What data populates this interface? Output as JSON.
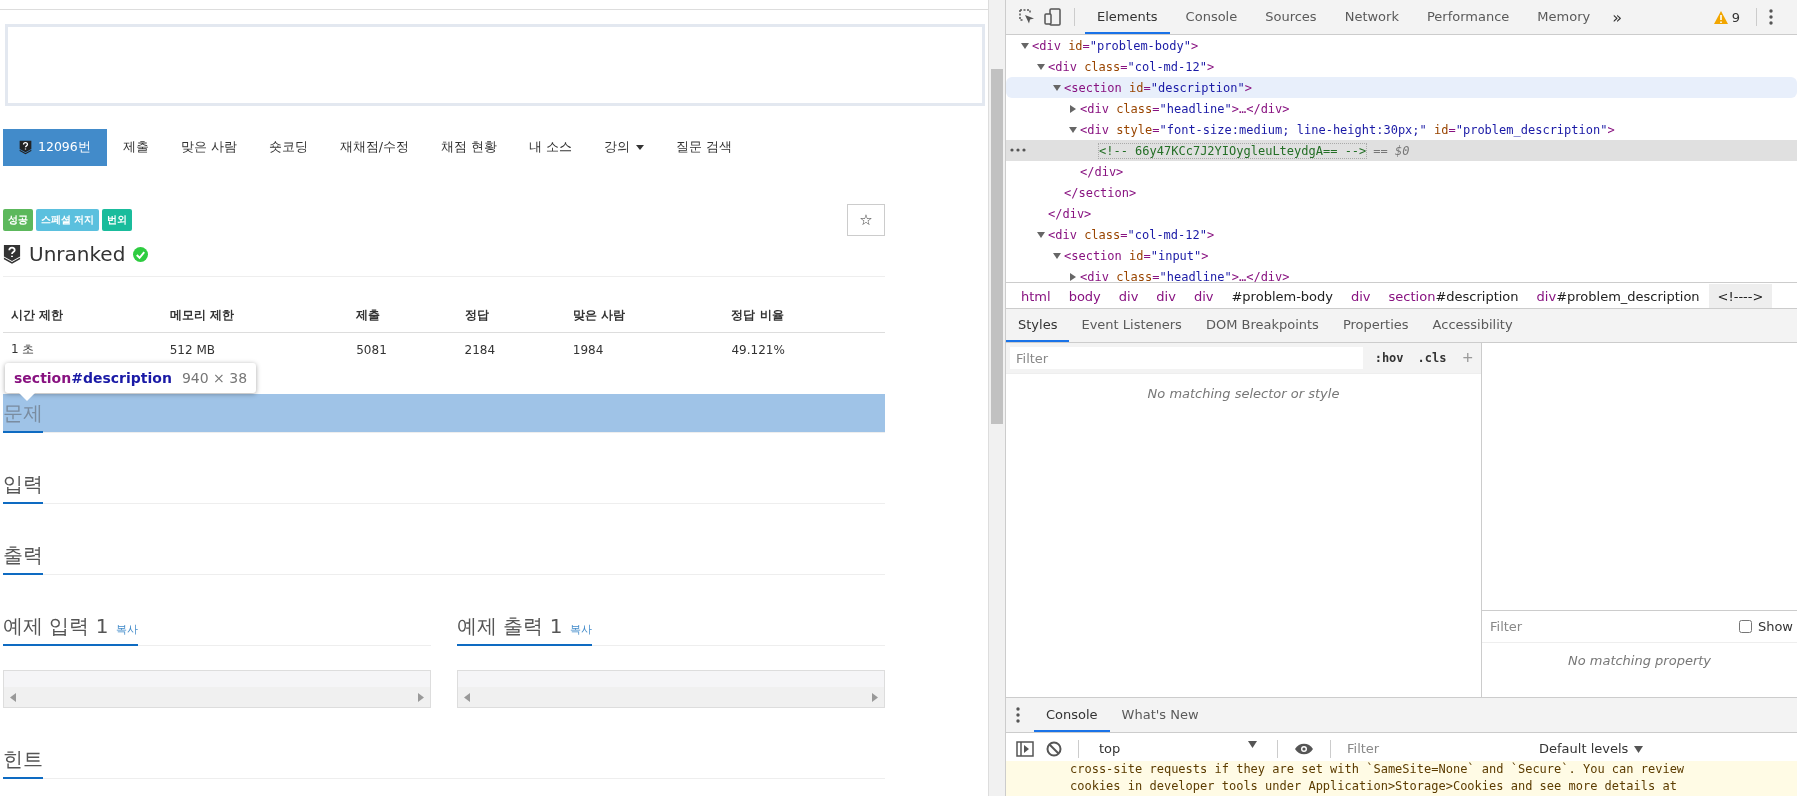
{
  "page": {
    "nav": [
      {
        "label": "12096번",
        "selected": true,
        "icon": true
      },
      {
        "label": "제출",
        "selected": false
      },
      {
        "label": "맞은 사람",
        "selected": false
      },
      {
        "label": "숏코딩",
        "selected": false
      },
      {
        "label": "재채점/수정",
        "selected": false
      },
      {
        "label": "채점 현황",
        "selected": false
      },
      {
        "label": "내 소스",
        "selected": false
      },
      {
        "label": "강의",
        "selected": false,
        "dropdown": true
      },
      {
        "label": "질문 검색",
        "selected": false
      }
    ],
    "tags": [
      {
        "label": "성공",
        "color": "#5cb85c"
      },
      {
        "label": "스페셜 저지",
        "color": "#5bc0de"
      },
      {
        "label": "번외",
        "color": "#1abc9c"
      }
    ],
    "star_button": {
      "label": "☆"
    },
    "rank": {
      "label": "Unranked",
      "solved": true
    },
    "table": {
      "columns": [
        "시간 제한",
        "메모리 제한",
        "제출",
        "정답",
        "맞은 사람",
        "정답 비율"
      ],
      "rows": [
        [
          "1 초",
          "512 MB",
          "5081",
          "2184",
          "1984",
          "49.121%"
        ]
      ]
    },
    "tooltip": {
      "tag": "section",
      "id": "#description",
      "size": "940 × 38"
    },
    "sections": [
      {
        "kind": "single",
        "title": "문제",
        "highlighted": true
      },
      {
        "kind": "single",
        "title": "입력",
        "highlighted": false
      },
      {
        "kind": "single",
        "title": "출력",
        "highlighted": false
      },
      {
        "kind": "samples",
        "items": [
          {
            "title": "예제 입력 1",
            "copy": "복사"
          },
          {
            "title": "예제 출력 1",
            "copy": "복사"
          }
        ]
      },
      {
        "kind": "single",
        "title": "힌트",
        "highlighted": false
      }
    ]
  },
  "devtools": {
    "tabs": [
      {
        "label": "Elements",
        "selected": true
      },
      {
        "label": "Console",
        "selected": false
      },
      {
        "label": "Sources",
        "selected": false
      },
      {
        "label": "Network",
        "selected": false
      },
      {
        "label": "Performance",
        "selected": false
      },
      {
        "label": "Memory",
        "selected": false
      }
    ],
    "more": "»",
    "warnings": "9",
    "tree": [
      {
        "open": "<div id=\"problem-body\">",
        "expanded": true,
        "children": [
          {
            "open": "<div class=\"col-md-12\">",
            "expanded": true,
            "close": "</div>",
            "children": [
              {
                "open": "<section id=\"description\">",
                "expanded": true,
                "hovered": true,
                "close": "</section>",
                "children": [
                  {
                    "open": "<div class=\"headline\">…</div>",
                    "expanded": false
                  },
                  {
                    "open": "<div style=\"font-size:medium; line-height:30px;\" id=\"problem_description\">",
                    "expanded": true,
                    "close": "</div>",
                    "children": [
                      {
                        "comment": "<!-- 66y47KCc7J2YIOygleuLteydgA== -->",
                        "suffix": "== $0",
                        "selected": true
                      }
                    ]
                  }
                ]
              }
            ]
          },
          {
            "open": "<div class=\"col-md-12\">",
            "expanded": true,
            "children": [
              {
                "open": "<section id=\"input\">",
                "expanded": true,
                "children": [
                  {
                    "open": "<div class=\"headline\">…</div>",
                    "expanded": false
                  }
                ]
              }
            ]
          }
        ]
      }
    ],
    "breadcrumbs": [
      {
        "label": "html",
        "selected": false
      },
      {
        "label": "body",
        "selected": false
      },
      {
        "label": "div",
        "selected": false
      },
      {
        "label": "div",
        "selected": false
      },
      {
        "label": "div",
        "selected": false
      },
      {
        "label": "#problem-body",
        "selected": false
      },
      {
        "label": "div",
        "selected": false
      },
      {
        "label": "section#description",
        "selected": false
      },
      {
        "label": "div#problem_description",
        "selected": false
      },
      {
        "label": "<!---->",
        "selected": true
      }
    ],
    "subtabs": [
      {
        "label": "Styles",
        "selected": true
      },
      {
        "label": "Event Listeners",
        "selected": false
      },
      {
        "label": "DOM Breakpoints",
        "selected": false
      },
      {
        "label": "Properties",
        "selected": false
      },
      {
        "label": "Accessibility",
        "selected": false
      }
    ],
    "styles": {
      "placeholder": "Filter",
      "hov": ":hov",
      "cls": ".cls",
      "add": "+",
      "empty": "No matching selector or style"
    },
    "computed": {
      "placeholder": "Filter",
      "show_label": "Show",
      "show_checked": false,
      "empty": "No matching property"
    },
    "drawer": {
      "tabs": [
        {
          "label": "Console",
          "selected": true
        },
        {
          "label": "What's New",
          "selected": false
        }
      ],
      "context": "top",
      "placeholder": "Filter",
      "levels": "Default levels",
      "messages": [
        "cross-site requests if they are set with `SameSite=None` and `Secure`. You can review",
        "cookies in developer tools under Application>Storage>Cookies and see more details at"
      ]
    }
  }
}
